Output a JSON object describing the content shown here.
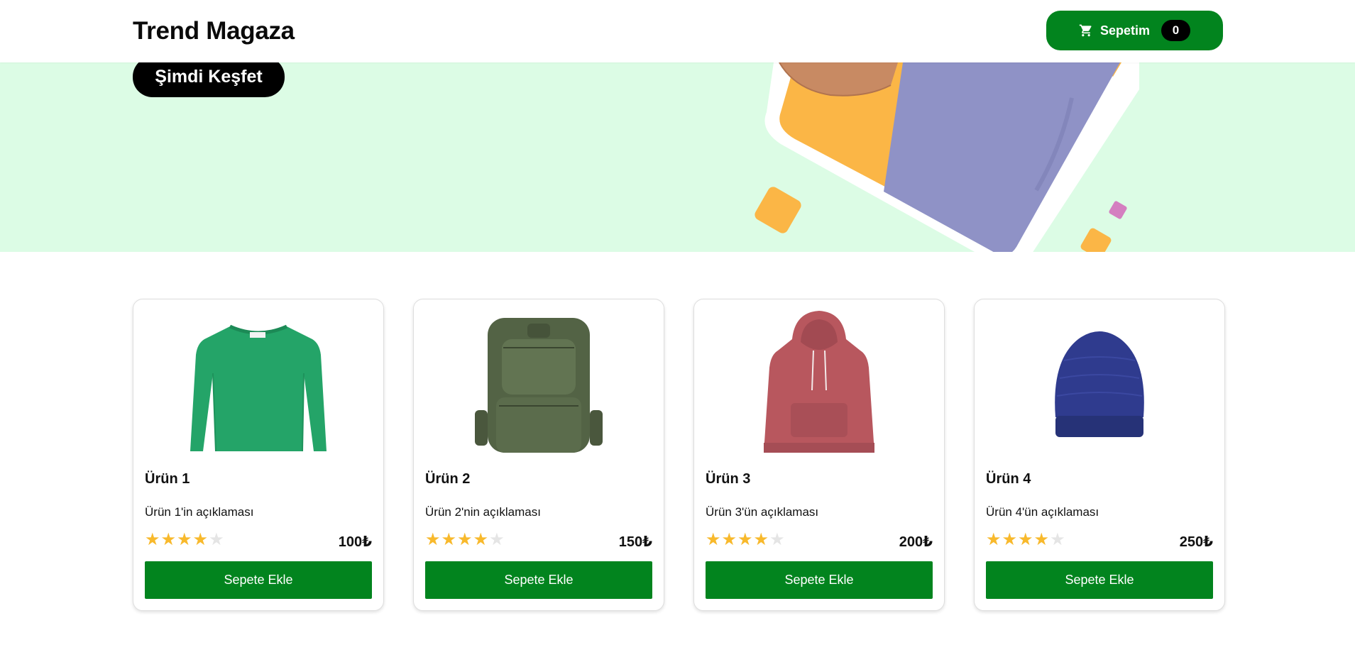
{
  "header": {
    "brand": "Trend Magaza",
    "cart_label": "Sepetim",
    "cart_count": "0",
    "cart_icon": "cart-icon"
  },
  "hero": {
    "cta_label": "Şimdi Keşfet"
  },
  "products": [
    {
      "title": "Ürün 1",
      "description": "Ürün 1'in açıklaması",
      "rating": 4,
      "max_rating": 5,
      "price": "100₺",
      "button": "Sepete Ekle",
      "image": "green-sweater"
    },
    {
      "title": "Ürün 2",
      "description": "Ürün 2'nin açıklaması",
      "rating": 4,
      "max_rating": 5,
      "price": "150₺",
      "button": "Sepete Ekle",
      "image": "olive-backpack"
    },
    {
      "title": "Ürün 3",
      "description": "Ürün 3'ün açıklaması",
      "rating": 4,
      "max_rating": 5,
      "price": "200₺",
      "button": "Sepete Ekle",
      "image": "red-hoodie"
    },
    {
      "title": "Ürün 4",
      "description": "Ürün 4'ün açıklaması",
      "rating": 4,
      "max_rating": 5,
      "price": "250₺",
      "button": "Sepete Ekle",
      "image": "blue-beanie"
    }
  ],
  "colors": {
    "accent_green": "#02841e",
    "hero_bg": "#dcfce5",
    "star": "#f8b92c",
    "star_empty": "#e5e5e5",
    "hero_orange": "#fbb646",
    "hero_pink": "#d47fc0"
  }
}
